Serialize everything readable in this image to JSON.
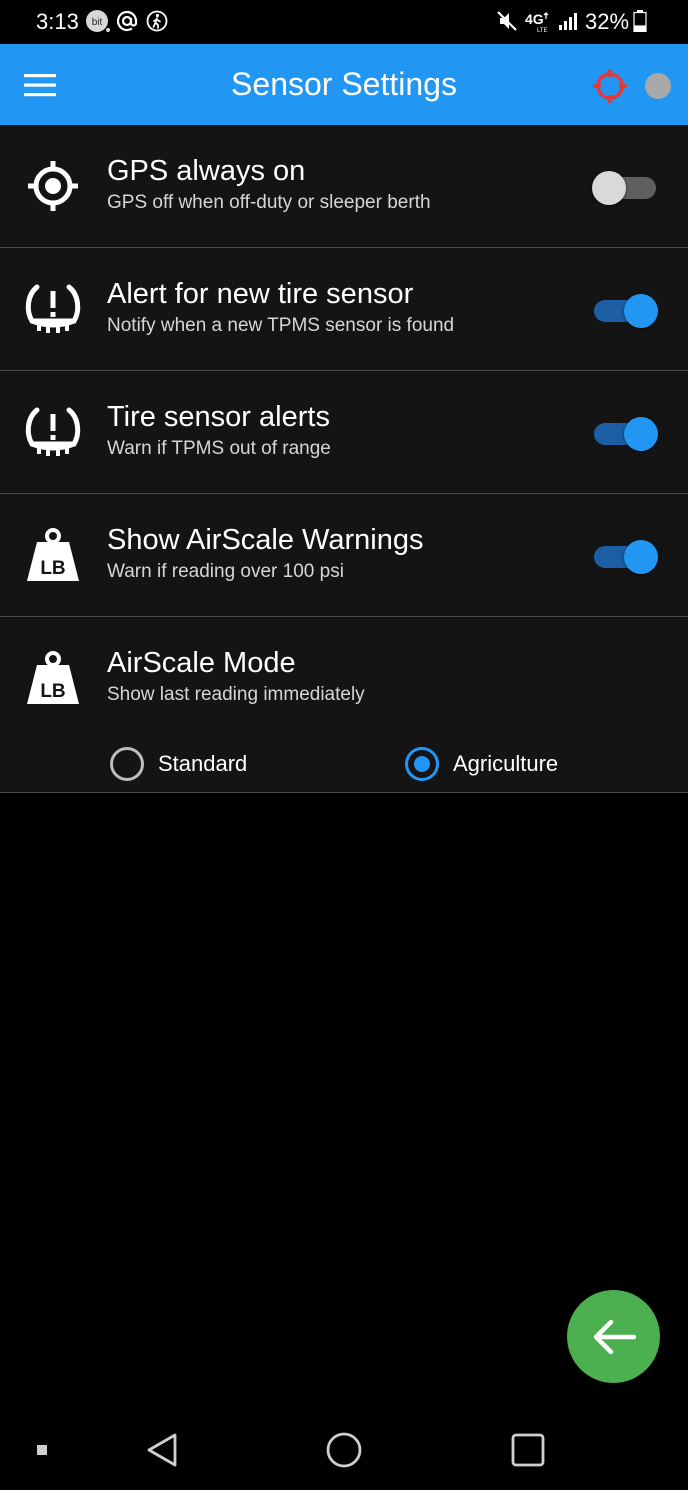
{
  "status_bar": {
    "time": "3:13",
    "left_icons": [
      "bitmoji-notification-icon",
      "at-sign-icon",
      "walking-person-icon"
    ],
    "right_icons": [
      "mute-icon",
      "4g-lte-icon",
      "signal-icon"
    ],
    "battery_percent": "32%",
    "battery_level": 0.32,
    "bit_badge": "bit"
  },
  "app_bar": {
    "title": "Sensor Settings",
    "accent_color": "#2196f3",
    "target_color": "#e53935"
  },
  "settings": [
    {
      "icon": "gps-crosshair-icon",
      "title": "GPS always on",
      "subtitle": "GPS off when off-duty or sleeper berth",
      "enabled": false
    },
    {
      "icon": "tire-pressure-icon",
      "title": "Alert for new tire sensor",
      "subtitle": "Notify when a new TPMS sensor is found",
      "enabled": true
    },
    {
      "icon": "tire-pressure-icon",
      "title": "Tire sensor alerts",
      "subtitle": "Warn if TPMS out of range",
      "enabled": true
    },
    {
      "icon": "weight-lb-icon",
      "title": "Show AirScale Warnings",
      "subtitle": "Warn if reading over 100 psi",
      "enabled": true
    }
  ],
  "airscale_mode": {
    "icon": "weight-lb-icon",
    "icon_text": "LB",
    "title": "AirScale Mode",
    "subtitle": "Show last reading immediately",
    "options": [
      {
        "label": "Standard",
        "selected": false
      },
      {
        "label": "Agriculture",
        "selected": true
      }
    ]
  },
  "fab": {
    "icon": "arrow-left-icon",
    "color": "#4caf50"
  },
  "nav_bar": {
    "icons": [
      "small-square-icon",
      "back-triangle-icon",
      "home-circle-icon",
      "recents-square-icon"
    ]
  }
}
